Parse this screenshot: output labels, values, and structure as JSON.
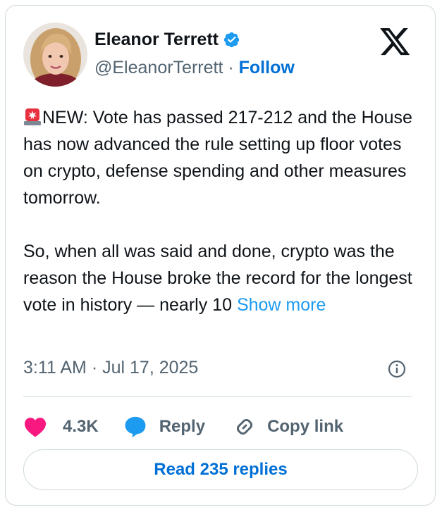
{
  "author": {
    "name": "Eleanor Terrett",
    "handle": "@EleanorTerrett",
    "separator": "·",
    "follow_label": "Follow"
  },
  "icons": {
    "verified": "verified-badge-icon",
    "platform": "x-logo-icon",
    "alarm": "rotating-light-emoji",
    "info": "info-icon",
    "like": "heart-icon",
    "reply": "speech-bubble-icon",
    "copy": "link-icon"
  },
  "tweet": {
    "paragraph1": "NEW: Vote has passed 217-212 and the House has now advanced the rule setting up floor votes on crypto, defense spending and other measures tomorrow.",
    "paragraph2": "So, when all was said and done, crypto was the reason the House broke the record for the longest vote in history — nearly 10",
    "show_more": "Show more"
  },
  "meta": {
    "time": "3:11 AM",
    "separator": "·",
    "date": "Jul 17, 2025"
  },
  "actions": {
    "like_count": "4.3K",
    "reply_label": "Reply",
    "copy_label": "Copy link"
  },
  "read_replies_label": "Read 235 replies",
  "colors": {
    "text": "#0f1419",
    "secondary": "#536471",
    "link": "#1d9bf0",
    "follow": "#006fd6",
    "like": "#f91880",
    "reply": "#1d9bf0",
    "border": "#cfd9de"
  }
}
